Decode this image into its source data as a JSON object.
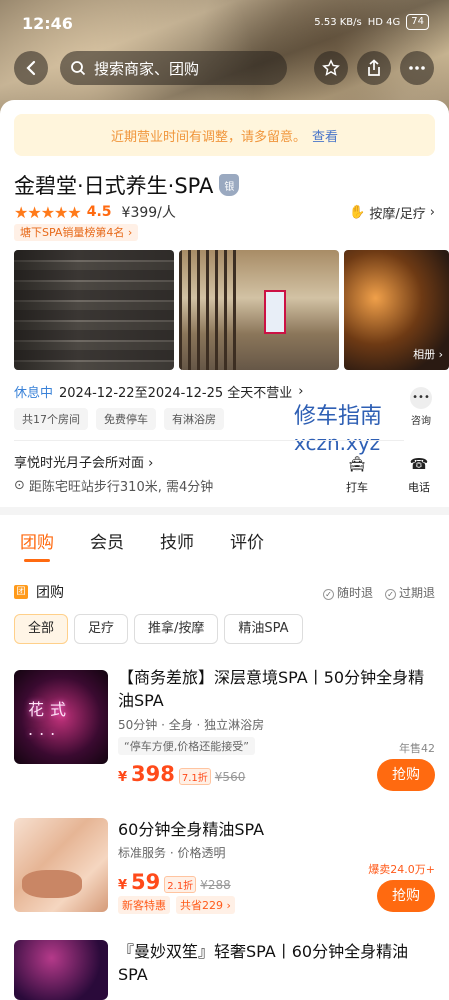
{
  "status": {
    "time": "12:46",
    "net": "5.53 KB/s",
    "signal": "HD 4G",
    "battery": "74"
  },
  "search": {
    "placeholder": "搜索商家、团购"
  },
  "icons": {
    "back": "back-arrow-icon",
    "search": "search-icon",
    "star": "star-icon",
    "share": "share-icon",
    "more": "more-icon"
  },
  "notice": {
    "text": "近期营业时间有调整，请多留意。",
    "link": "查看"
  },
  "shop": {
    "name": "金碧堂·日式养生·SPA",
    "badge": "银",
    "rating": "4.5",
    "stars": "★★★★★",
    "price": "¥399/人",
    "category": "按摩/足疗",
    "rank": "塘下SPA销量榜第4名 ›",
    "album": "相册 ›"
  },
  "hours": {
    "label": "休息中",
    "text": "2024-12-22至2024-12-25 全天不营业",
    "arrow": "›"
  },
  "facilities": [
    "共17个房间",
    "免费停车",
    "有淋浴房"
  ],
  "consult": {
    "label": "咨询",
    "icon": "chat-icon"
  },
  "watermark": {
    "line1": "修车指南",
    "line2": "xczn.xyz"
  },
  "address": {
    "line": "享悦时光月子会所对面 ›",
    "distance": "距陈宅旺站步行310米, 需4分钟"
  },
  "actions": {
    "taxi": "打车",
    "phone": "电话"
  },
  "tabs": [
    "团购",
    "会员",
    "技师",
    "评价"
  ],
  "group": {
    "logo": "团",
    "title": "团购",
    "policy1": "随时退",
    "policy2": "过期退"
  },
  "filters": [
    "全部",
    "足疗",
    "推拿/按摩",
    "精油SPA"
  ],
  "deals": [
    {
      "title": "【商务差旅】深层意境SPA丨50分钟全身精油SPA",
      "sub": "50分钟 · 全身 · 独立淋浴房",
      "quote": "“停车方便,价格还能接受”",
      "sold": "年售42",
      "currency": "¥",
      "price": "398",
      "discount": "7.1折",
      "original": "¥560",
      "buy": "抢购",
      "thumb_text": "花式 ..."
    },
    {
      "title": "60分钟全身精油SPA",
      "sub": "标准服务 · 价格透明",
      "sold": "爆卖24.0万+",
      "currency": "¥",
      "price": "59",
      "discount": "2.1折",
      "original": "¥288",
      "buy": "抢购",
      "promo1": "新客特惠",
      "promo2": "共省229 ›"
    },
    {
      "title": "『曼妙双笙』轻奢SPA丨60分钟全身精油SPA"
    }
  ]
}
